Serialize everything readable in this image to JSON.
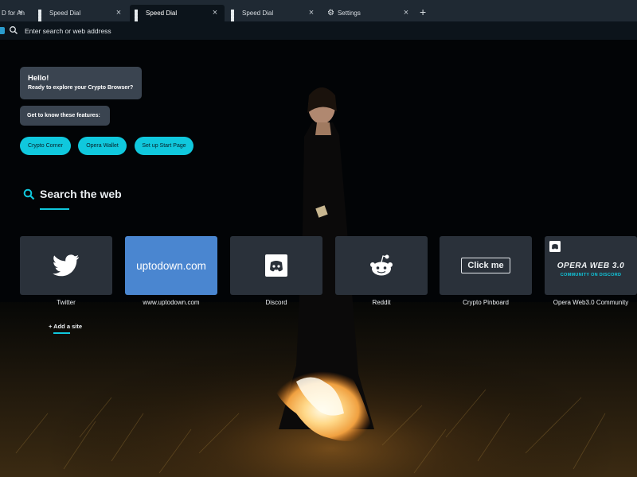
{
  "tabs": [
    {
      "label": "D for An",
      "icon": "opera-icon",
      "active": false
    },
    {
      "label": "Speed Dial",
      "icon": "speed-dial-grid-icon",
      "active": false
    },
    {
      "label": "Speed Dial",
      "icon": "speed-dial-grid-icon",
      "active": true
    },
    {
      "label": "Speed Dial",
      "icon": "speed-dial-grid-icon",
      "active": false
    },
    {
      "label": "Settings",
      "icon": "gear-icon",
      "active": false
    }
  ],
  "new_tab_label": "+",
  "address_bar": {
    "placeholder": "Enter search or web address",
    "value": ""
  },
  "assistant": {
    "hello_title": "Hello!",
    "hello_text": "Ready to explore your Crypto Browser?",
    "features_text": "Get to know these features:",
    "buttons": [
      "Crypto Corner",
      "Opera Wallet",
      "Set up Start Page"
    ]
  },
  "search_web": {
    "title": "Search the web"
  },
  "speed_dial": [
    {
      "label": "Twitter",
      "icon": "twitter-bird-icon"
    },
    {
      "label": "www.uptodown.com",
      "tile_text": "uptodown.com"
    },
    {
      "label": "Discord",
      "icon": "discord-icon"
    },
    {
      "label": "Reddit",
      "icon": "reddit-icon"
    },
    {
      "label": "Crypto Pinboard",
      "tile_text": "Click me"
    },
    {
      "label": "Opera Web3.0 Community",
      "tile_title": "OPERA WEB 3.0",
      "tile_subtitle": "COMMUNITY ON DISCORD"
    }
  ],
  "add_site": "+ Add a site",
  "colors": {
    "accent": "#10c8dd",
    "tile_bg": "#2a313a",
    "uptodown_bg": "#4a86d0",
    "bubble_bg": "#3a4450",
    "tabstrip_bg": "#1f2933"
  }
}
